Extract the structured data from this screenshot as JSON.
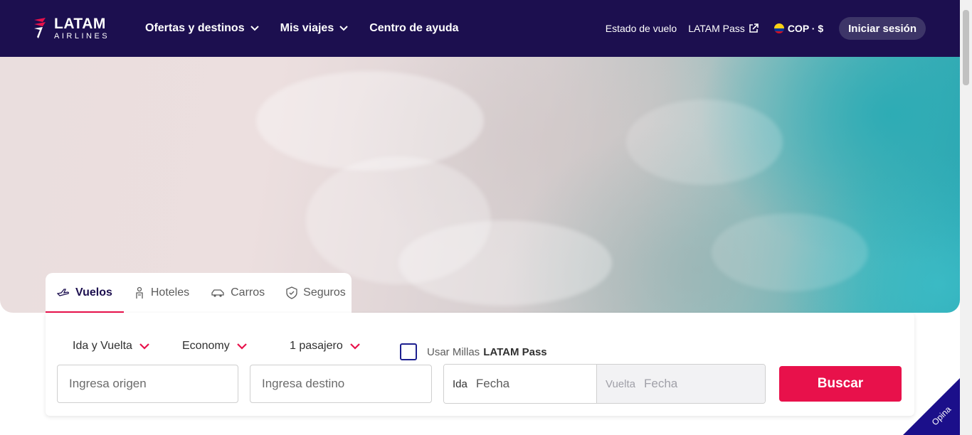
{
  "header": {
    "logo": {
      "name": "LATAM",
      "sub": "AIRLINES"
    },
    "nav": [
      {
        "label": "Ofertas y destinos",
        "has_dropdown": true
      },
      {
        "label": "Mis viajes",
        "has_dropdown": true
      },
      {
        "label": "Centro de ayuda",
        "has_dropdown": false
      }
    ],
    "right": {
      "flight_status": "Estado de vuelo",
      "latam_pass": "LATAM Pass",
      "currency": "COP · $",
      "login": "Iniciar sesión"
    }
  },
  "search": {
    "tabs": [
      {
        "label": "Vuelos",
        "icon": "plane-icon",
        "active": true
      },
      {
        "label": "Hoteles",
        "icon": "bellhop-icon",
        "active": false
      },
      {
        "label": "Carros",
        "icon": "car-icon",
        "active": false
      },
      {
        "label": "Seguros",
        "icon": "shield-icon",
        "active": false
      }
    ],
    "trip_type": "Ida y Vuelta",
    "cabin": "Economy",
    "passengers": "1 pasajero",
    "miles_prefix": "Usar Millas",
    "miles_brand": "LATAM Pass",
    "origin_placeholder": "Ingresa origen",
    "destination_placeholder": "Ingresa destino",
    "ida_label": "Ida",
    "ida_value": "Fecha",
    "vuelta_label": "Vuelta",
    "vuelta_value": "Fecha",
    "search_button": "Buscar"
  },
  "feedback": {
    "label": "Opina"
  },
  "colors": {
    "header_bg": "#1c0f4f",
    "accent": "#e8114b",
    "brand_blue": "#1b0f8a"
  }
}
